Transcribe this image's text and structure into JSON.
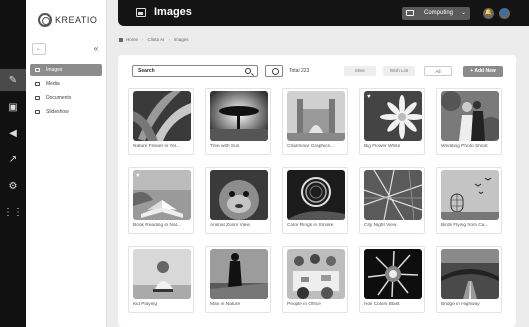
{
  "app": {
    "logo_text": "KREATIO"
  },
  "rail": {
    "items": [
      "edit-icon",
      "image-icon",
      "megaphone-icon",
      "chart-icon",
      "gear-icon",
      "grid-icon"
    ]
  },
  "sidebar": {
    "back_label": "←",
    "collapse_label": "«",
    "items": [
      {
        "label": "Images",
        "icon": "image-icon",
        "active": true
      },
      {
        "label": "Media",
        "icon": "media-icon",
        "active": false
      },
      {
        "label": "Documents",
        "icon": "document-icon",
        "active": false
      },
      {
        "label": "Slideshow",
        "icon": "slideshow-icon",
        "active": false
      }
    ]
  },
  "header": {
    "title": "Images",
    "env_label": "Computing",
    "env_caret": "⌄",
    "bell_icon": "🔔",
    "user_icon": "👤"
  },
  "breadcrumb": {
    "home": "Home",
    "site": "Clinta AI",
    "page": "Images",
    "sep": "›"
  },
  "toolbar": {
    "search_label": "Search",
    "total": "Total 223",
    "filters": [
      "Mine",
      "Wish List",
      "All"
    ],
    "active_filter": "All",
    "add_label": "+ Add New"
  },
  "cards": [
    {
      "caption": "Nature Flower in Yel...",
      "favorite": false
    },
    {
      "caption": "Tree with Sun",
      "favorite": false
    },
    {
      "caption": "Charminar Graphics...",
      "favorite": false
    },
    {
      "caption": "Big Flower White",
      "favorite": true
    },
    {
      "caption": "Wedding Photo Shoot",
      "favorite": false
    },
    {
      "caption": "Book Reading in Nat...",
      "favorite": true
    },
    {
      "caption": "Animal Zoom View",
      "favorite": false
    },
    {
      "caption": "Color Rings in Smoke",
      "favorite": false
    },
    {
      "caption": "City Night View",
      "favorite": false
    },
    {
      "caption": "Birds Flying from Ca...",
      "favorite": false
    },
    {
      "caption": "Kid Playing",
      "favorite": false
    },
    {
      "caption": "Man in Nature",
      "favorite": false
    },
    {
      "caption": "People in Office",
      "favorite": false
    },
    {
      "caption": "Holi Colors Blast",
      "favorite": false
    },
    {
      "caption": "Bridge in Highway",
      "favorite": false
    }
  ],
  "colors": {
    "dark": "#141414",
    "accent": "#8a8a8a"
  }
}
